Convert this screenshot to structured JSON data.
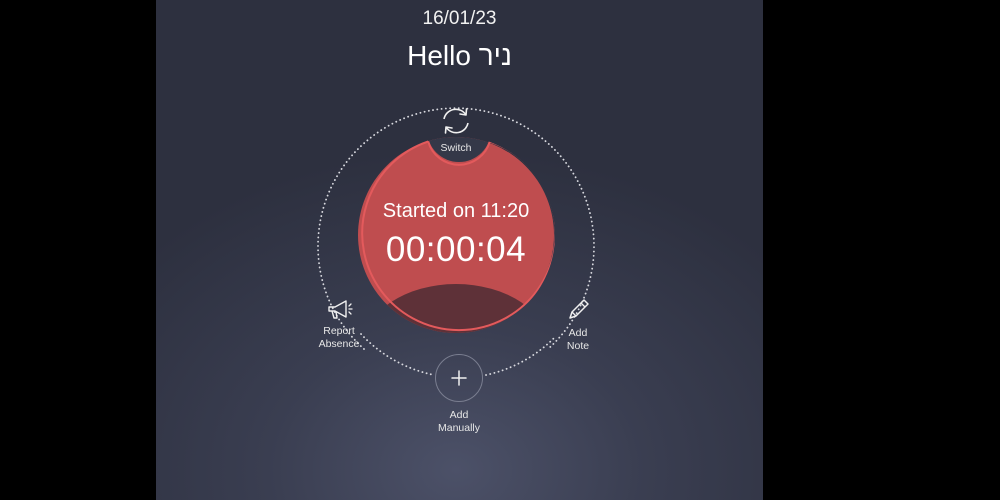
{
  "header": {
    "date": "16/01/23",
    "greeting": "Hello ניר"
  },
  "timer": {
    "started_text": "Started on 11:20",
    "elapsed": "00:00:04"
  },
  "actions": {
    "switch": {
      "label": "Switch",
      "icon": "switch-arrows-icon"
    },
    "report_absence": {
      "label_line1": "Report",
      "label_line2": "Absence",
      "icon": "megaphone-icon"
    },
    "add_note": {
      "label_line1": "Add",
      "label_line2": "Note",
      "icon": "pencil-icon"
    },
    "add_manually": {
      "label_line1": "Add",
      "label_line2": "Manually",
      "icon": "plus-icon"
    }
  },
  "colors": {
    "background": "#333647",
    "timer_fill": "#bf4d4f",
    "timer_border": "#e35a5c",
    "timer_shadow": "#5e3138"
  }
}
